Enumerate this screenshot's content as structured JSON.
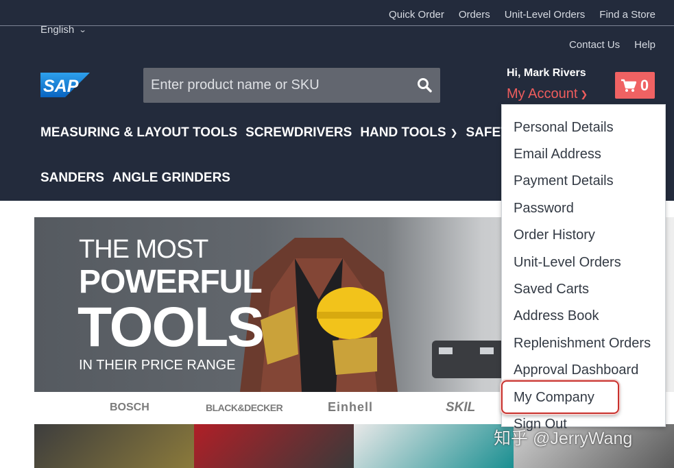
{
  "top_links": [
    "Quick Order",
    "Orders",
    "Unit-Level Orders",
    "Find a Store"
  ],
  "sub_links": [
    "Contact Us",
    "Help"
  ],
  "language": {
    "label": "English",
    "icon": "chevron-down-icon"
  },
  "logo": {
    "text": "SAP",
    "color": "#1a7fd1"
  },
  "search": {
    "placeholder": "Enter product name or SKU",
    "icon": "search-icon"
  },
  "account": {
    "greeting": "Hi, Mark Rivers",
    "label": "My Account",
    "accent": "#ef5d5d"
  },
  "cart": {
    "count": "0",
    "icon": "cart-icon",
    "color": "#f06263"
  },
  "nav": {
    "row1": [
      "MEASURING & LAYOUT TOOLS",
      "SCREWDRIVERS",
      "HAND TOOLS",
      "SAFETY"
    ],
    "row2": [
      "SANDERS",
      "ANGLE GRINDERS"
    ]
  },
  "banner": {
    "line1": "THE MOST",
    "line2": "POWERFUL",
    "line3": "TOOLS",
    "line4": "IN THEIR PRICE RANGE"
  },
  "brands": [
    "BOSCH",
    "BLACK&DECKER",
    "Einhell",
    "SKIL"
  ],
  "account_menu": {
    "items": [
      "Personal Details",
      "Email Address",
      "Payment Details",
      "Password",
      "Order History",
      "Unit-Level Orders",
      "Saved Carts",
      "Address Book",
      "Replenishment Orders",
      "Approval Dashboard",
      "My Company",
      "Sign Out"
    ],
    "highlighted": "My Company",
    "highlight_color": "#c9302c"
  },
  "watermark": "知乎 @JerryWang",
  "colors": {
    "header_bg": "#232b3c",
    "text_light": "#d7dbe2"
  }
}
